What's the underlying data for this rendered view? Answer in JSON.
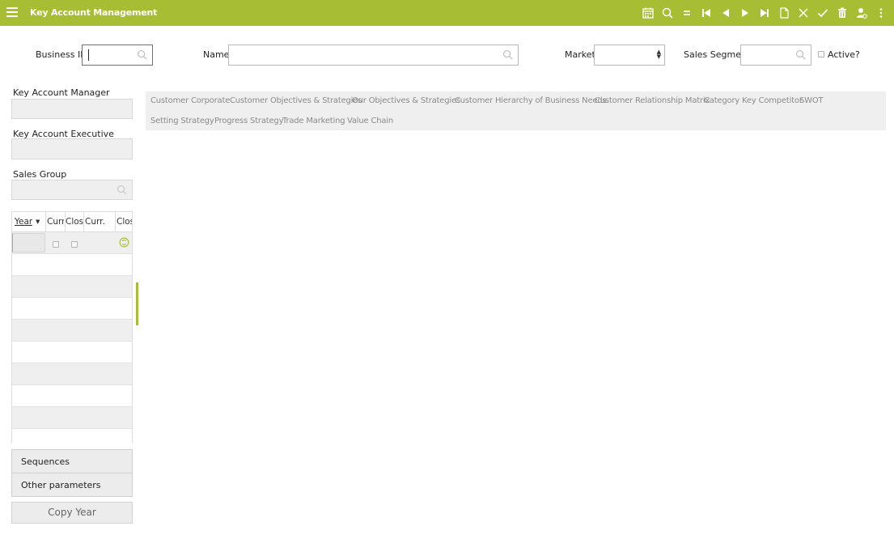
{
  "header": {
    "title": "Key Account Management",
    "toolbar_icons": [
      "calendar-icon",
      "search-icon",
      "equals-icon",
      "first-record-icon",
      "previous-record-icon",
      "next-record-icon",
      "last-record-icon",
      "new-document-icon",
      "close-icon",
      "check-icon",
      "delete-icon",
      "user-settings-icon",
      "more-vertical-icon"
    ]
  },
  "filters": {
    "business_id_label": "Business ID",
    "business_id_value": "",
    "name_label": "Name",
    "name_value": "",
    "market_label": "Market",
    "market_value": "",
    "sales_segment_label": "Sales Segment",
    "sales_segment_value": "",
    "active_label": "Active?"
  },
  "left": {
    "kam_label": "Key Account Manager",
    "kam_value": "",
    "kae_label": "Key Account Executive",
    "kae_value": "",
    "sales_group_label": "Sales Group",
    "sales_group_value": ""
  },
  "grid": {
    "columns": [
      "Year",
      "Curr",
      "Clos",
      "Curr.",
      "Clos"
    ],
    "rows": [
      "",
      "",
      "",
      "",
      "",
      "",
      "",
      "",
      "",
      ""
    ]
  },
  "tabs": [
    "Customer Corporate",
    "Customer Objectives & Strategies",
    "Our Objectives & Strategies",
    "Customer Hierarchy of Business Needs",
    "Customer Relationship Matrix",
    "Category Key Competitor",
    "SWOT",
    "Setting Strategy",
    "Progress Strategy",
    "Trade Marketing",
    "Value Chain"
  ],
  "buttons": {
    "sequences": "Sequences",
    "other_parameters": "Other parameters",
    "copy_year": "Copy Year"
  },
  "colors": {
    "accent": "#a7bd33",
    "tab_bar": "#efefef",
    "readonly_field": "#efefef"
  }
}
